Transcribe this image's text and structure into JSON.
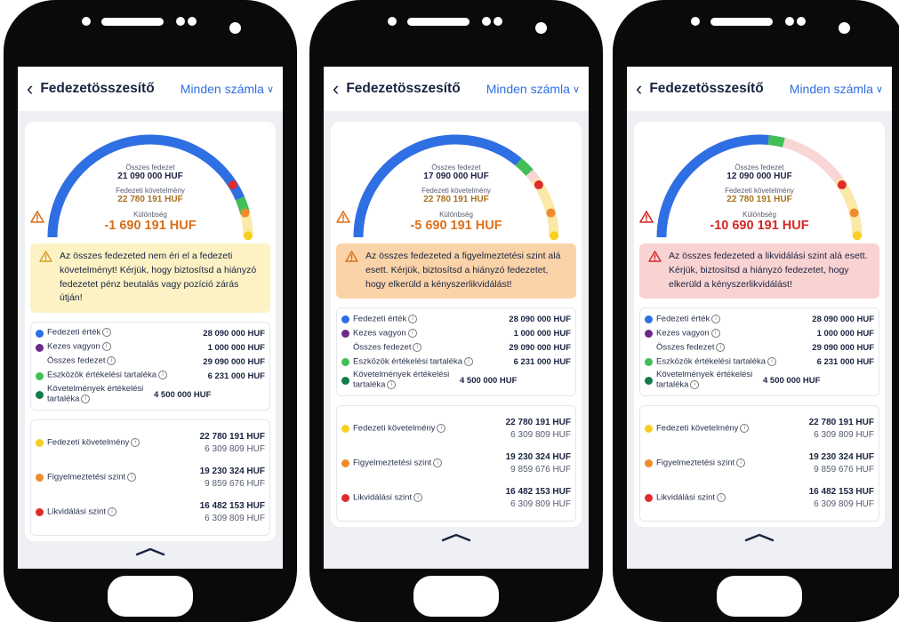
{
  "header": {
    "title": "Fedezetösszesítő",
    "account_select": "Minden számla"
  },
  "labels": {
    "total_collateral": "Összes fedezet",
    "requirement": "Fedezeti követelmény",
    "difference": "Különbség"
  },
  "breakdown": {
    "fedezeti_ertek": "Fedezeti érték",
    "kezes_vagyon": "Kezes vagyon",
    "osszes_fedezet": "Összes fedezet",
    "eszkozok": "Eszközök értékelési tartaléka",
    "kovetelmenyek": "Követelmények értékelési tartaléka"
  },
  "levels": {
    "fedezeti_kovetelmeny": "Fedezeti követelmény",
    "figyelmeztetesi_szint": "Figyelmeztetési szint",
    "likvidalasi_szint": "Likvidálási szint"
  },
  "colors": {
    "blue": "#2f6fe4",
    "purple": "#6b2a8a",
    "green": "#3fbf56",
    "dark_green": "#137a4b",
    "yellow": "#f5d020",
    "orange": "#f08a2c",
    "red": "#e02b2b"
  },
  "phones": [
    {
      "total": "21 090 000 HUF",
      "requirement": "22 780 191 HUF",
      "difference": "-1 690 191 HUF",
      "status": "yellow",
      "gauge_fill": 0.87,
      "alert": "Az összes fedezeted nem éri el a fedezeti követelményt! Kérjük, hogy biztosítsd a hiányzó fedezetet pénz beutalás vagy pozíció zárás útján!",
      "rows": {
        "fedezeti_ertek": "28 090 000 HUF",
        "kezes_vagyon": "1 000 000 HUF",
        "osszes_fedezet": "29 090 000 HUF",
        "eszkozok": "6 231 000 HUF",
        "kovetelmenyek": "4 500 000 HUF",
        "req_a": "22 780 191 HUF",
        "req_b": "6 309 809 HUF",
        "warn_a": "19 230 324 HUF",
        "warn_b": "9 859 676 HUF",
        "liq_a": "16 482 153 HUF",
        "liq_b": "6 309 809 HUF"
      }
    },
    {
      "total": "17 090 000 HUF",
      "requirement": "22 780 191 HUF",
      "difference": "-5 690 191 HUF",
      "status": "orange",
      "gauge_fill": 0.72,
      "alert": "Az összes fedezeted a figyelmeztetési szint alá esett. Kérjük, biztosítsd a hiányzó fedezetet, hogy elkerüld a kényszerlikvidálást!",
      "rows": {
        "fedezeti_ertek": "28 090 000 HUF",
        "kezes_vagyon": "1 000 000 HUF",
        "osszes_fedezet": "29 090 000 HUF",
        "eszkozok": "6 231 000 HUF",
        "kovetelmenyek": "4 500 000 HUF",
        "req_a": "22 780 191 HUF",
        "req_b": "6 309 809 HUF",
        "warn_a": "19 230 324 HUF",
        "warn_b": "9 859 676 HUF",
        "liq_a": "16 482 153 HUF",
        "liq_b": "6 309 809 HUF"
      }
    },
    {
      "total": "12 090 000 HUF",
      "requirement": "22 780 191 HUF",
      "difference": "-10 690 191 HUF",
      "status": "red",
      "gauge_fill": 0.53,
      "alert": "Az összes fedezeted a likvidálási szint alá esett. Kérjük, biztosítsd a hiányzó fedezetet, hogy elkerüld a kényszerlikvidálást!",
      "rows": {
        "fedezeti_ertek": "28 090 000 HUF",
        "kezes_vagyon": "1 000 000 HUF",
        "osszes_fedezet": "29 090 000 HUF",
        "eszkozok": "6 231 000 HUF",
        "kovetelmenyek": "4 500 000 HUF",
        "req_a": "22 780 191 HUF",
        "req_b": "6 309 809 HUF",
        "warn_a": "19 230 324 HUF",
        "warn_b": "9 859 676 HUF",
        "liq_a": "16 482 153 HUF",
        "liq_b": "6 309 809 HUF"
      }
    }
  ]
}
